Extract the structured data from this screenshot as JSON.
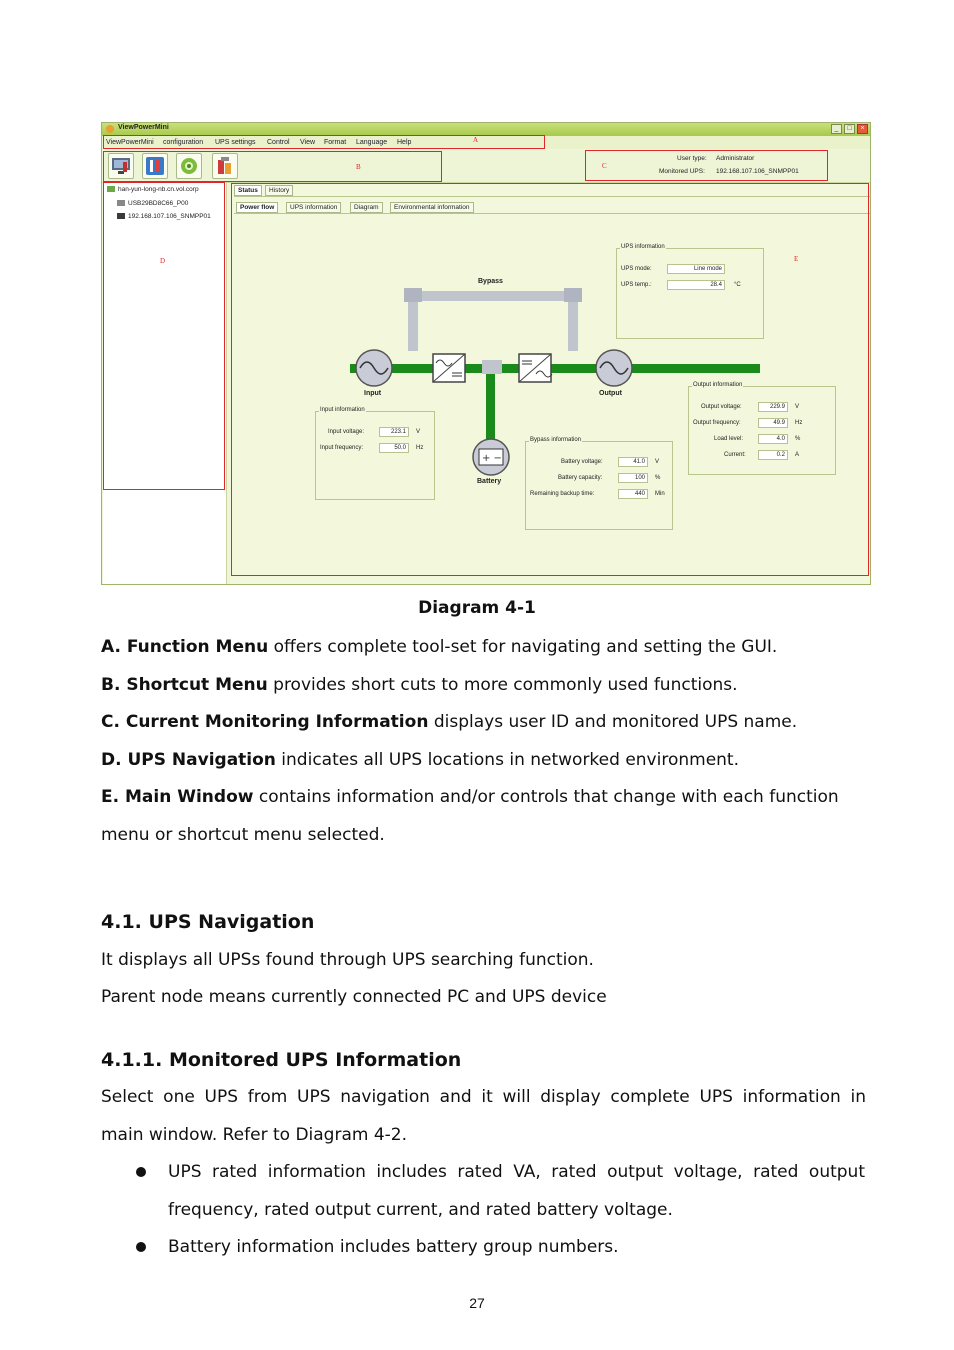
{
  "figure": {
    "app_title": "ViewPowerMini",
    "menu": [
      "ViewPowerMini",
      "configuration",
      "UPS settings",
      "Control",
      "View",
      "Format",
      "Language",
      "Help"
    ],
    "user_type_label": "User type:",
    "user_type_value": "Administrator",
    "monitored_ups_label": "Monitored UPS:",
    "monitored_ups_value": "192.168.107.106_SNMPP01",
    "nav_items": [
      "han-yun-long-nb.cn.vol.corp",
      "USB29BD8C66_P00",
      "192.168.107.106_SNMPP01"
    ],
    "tabs_top": [
      "Status",
      "History"
    ],
    "tabs_sub": [
      "Power flow",
      "UPS information",
      "Diagram",
      "Environmental information"
    ],
    "markers": {
      "a": "A",
      "b": "B",
      "c": "C",
      "d": "D",
      "e": "E"
    },
    "diagram_labels": {
      "bypass": "Bypass",
      "input": "Input",
      "output": "Output",
      "battery": "Battery"
    },
    "ups_info": {
      "title": "UPS information",
      "mode_label": "UPS mode:",
      "mode_value": "Line mode",
      "temp_label": "UPS temp.:",
      "temp_value": "28.4",
      "temp_unit": "°C"
    },
    "input_info": {
      "title": "Input information",
      "voltage_label": "Input voltage:",
      "voltage_value": "223.1",
      "voltage_unit": "V",
      "freq_label": "Input frequency:",
      "freq_value": "50.0",
      "freq_unit": "Hz"
    },
    "bypass_info": {
      "title": "Bypass information",
      "bv_label": "Battery voltage:",
      "bv_value": "41.0",
      "bv_unit": "V",
      "bc_label": "Battery capacity:",
      "bc_value": "100",
      "bc_unit": "%",
      "bt_label": "Remaining backup time:",
      "bt_value": "440",
      "bt_unit": "Min"
    },
    "output_info": {
      "title": "Output information",
      "ov_label": "Output voltage:",
      "ov_value": "229.9",
      "ov_unit": "V",
      "of_label": "Output frequency:",
      "of_value": "49.9",
      "of_unit": "Hz",
      "ll_label": "Load level:",
      "ll_value": "4.0",
      "ll_unit": "%",
      "cu_label": "Current:",
      "cu_value": "0.2",
      "cu_unit": "A"
    }
  },
  "caption": "Diagram 4-1",
  "definitions": [
    {
      "term": "A. Function Menu",
      "text": " offers complete tool-set for navigating and setting the GUI."
    },
    {
      "term": "B. Shortcut Menu",
      "text": " provides short cuts to more commonly used functions."
    },
    {
      "term": "C. Current Monitoring Information",
      "text": " displays user ID and monitored UPS name."
    },
    {
      "term": "D. UPS Navigation",
      "text": " indicates all UPS locations in networked environment."
    },
    {
      "term": "E. Main Window",
      "text": " contains information and/or controls that change with each function"
    }
  ],
  "definition_e_cont": "menu or shortcut menu selected.",
  "section_41": {
    "heading_num": "4.1.",
    "heading_text": "UPS Navigation",
    "line1": "It displays all UPSs found through UPS searching function.",
    "line2": "Parent node means currently connected PC and UPS device"
  },
  "section_411": {
    "heading_num": "4.1.1.",
    "heading_text": "Monitored UPS Information",
    "line1": "Select one UPS from UPS navigation and it will display complete UPS information in",
    "line2": "main window. Refer to Diagram 4-2."
  },
  "bullets": [
    {
      "line1": "UPS rated information includes rated VA, rated output voltage, rated output",
      "line2": "frequency, rated output current, and rated battery voltage."
    },
    {
      "line1": "Battery information includes battery group numbers."
    }
  ],
  "page_number": "27",
  "colors": {
    "marker_red": "#e0262a",
    "flow_green": "#1a8a1a",
    "bypass_gray": "#c0c4cc"
  }
}
